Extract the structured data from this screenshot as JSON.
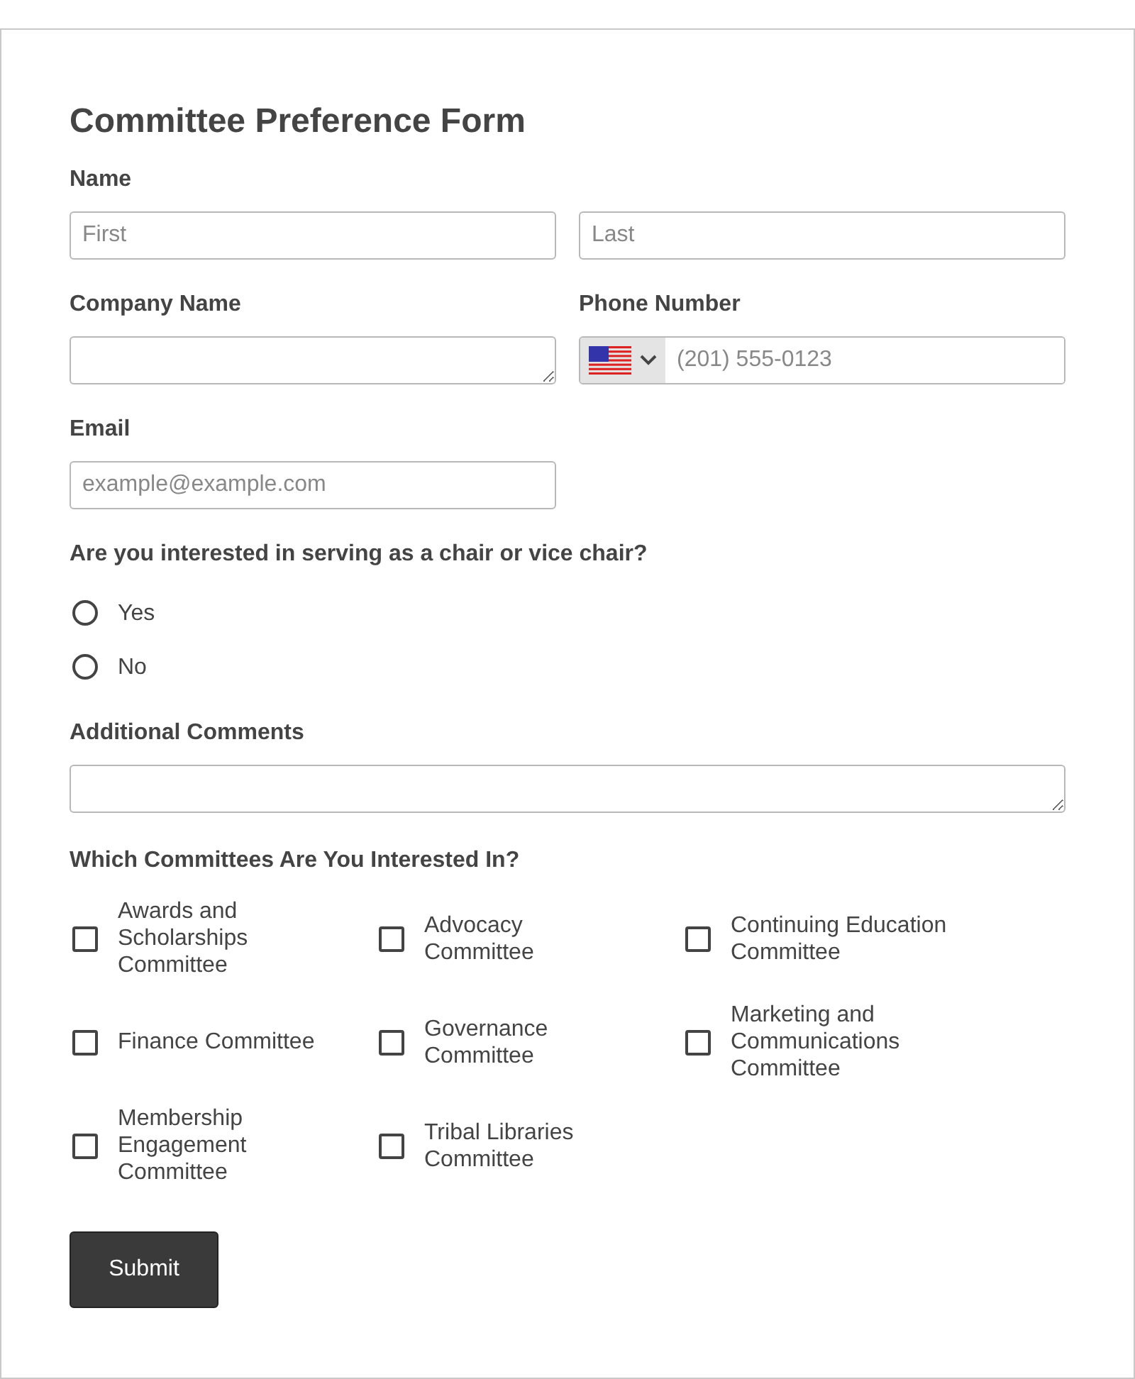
{
  "title": "Committee Preference Form",
  "name": {
    "label": "Name",
    "first": {
      "placeholder": "First"
    },
    "last": {
      "placeholder": "Last"
    }
  },
  "company": {
    "label": "Company Name"
  },
  "phone": {
    "label": "Phone Number",
    "placeholder": "(201) 555-0123"
  },
  "email": {
    "label": "Email",
    "placeholder": "example@example.com"
  },
  "chair_question": {
    "label": "Are you interested in serving as a chair or vice chair?",
    "options": [
      {
        "label": "Yes",
        "selected": false
      },
      {
        "label": "No",
        "selected": false
      }
    ]
  },
  "comments": {
    "label": "Additional Comments"
  },
  "committees": {
    "label": "Which Committees Are You Interested In?",
    "options": [
      {
        "label": "Awards and Scholarships Committee",
        "checked": false
      },
      {
        "label": "Advocacy Committee",
        "checked": false
      },
      {
        "label": "Continuing Education Committee",
        "checked": false
      },
      {
        "label": "Finance Committee",
        "checked": false
      },
      {
        "label": "Governance Committee",
        "checked": false
      },
      {
        "label": "Marketing and Communications Committee",
        "checked": false
      },
      {
        "label": "Membership Engagement Committee",
        "checked": false
      },
      {
        "label": "Tribal Libraries Committee",
        "checked": false
      }
    ]
  },
  "submit": "Submit"
}
